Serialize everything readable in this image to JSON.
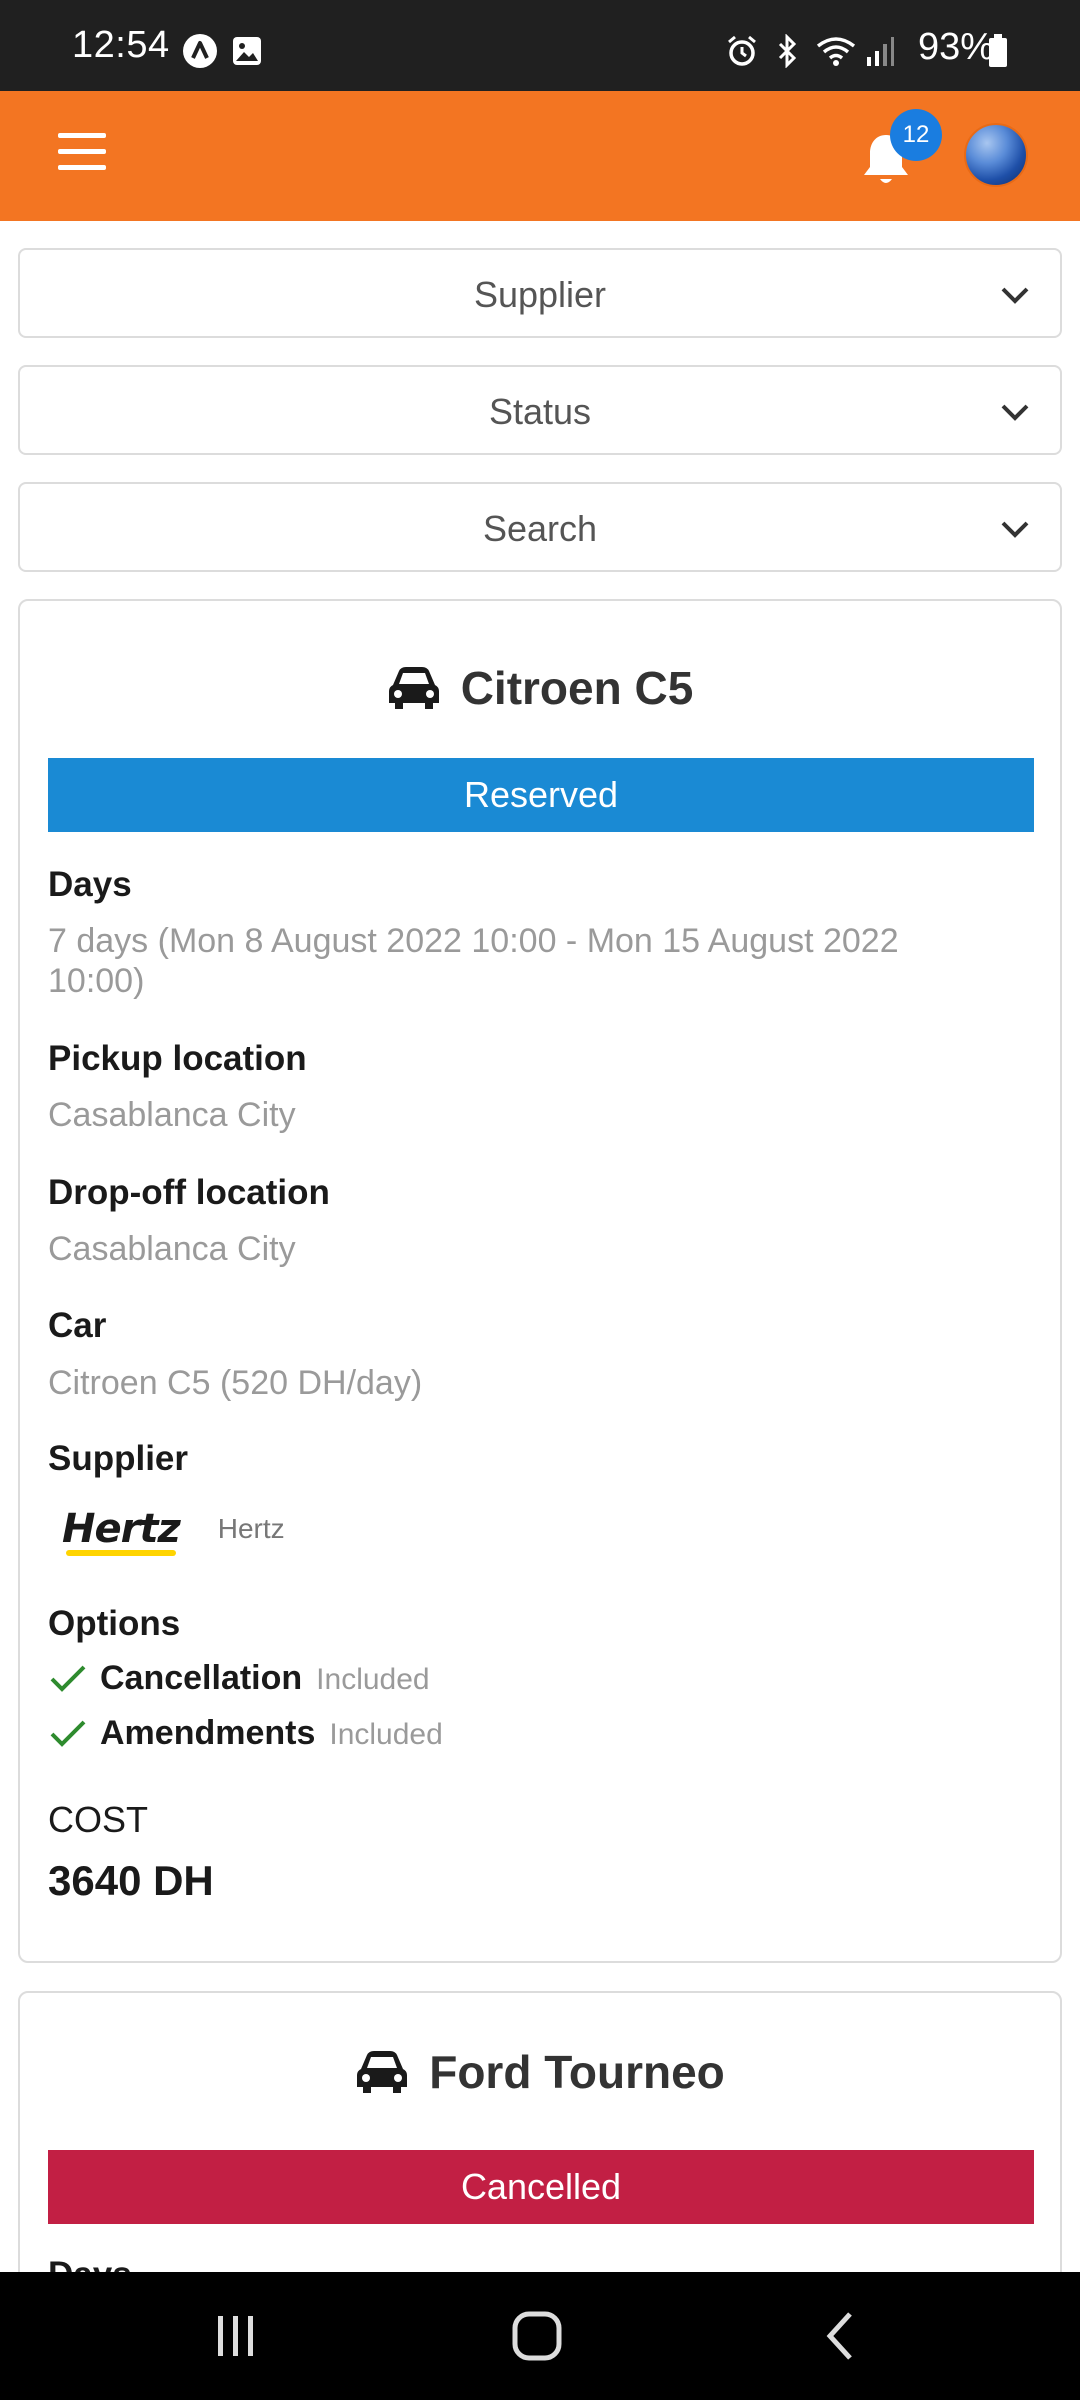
{
  "status_bar": {
    "time": "12:54",
    "battery_text": "93%",
    "icons": [
      "a-circle-icon",
      "image-icon",
      "alarm-icon",
      "bluetooth-icon",
      "wifi-icon",
      "signal-icon",
      "battery-icon"
    ]
  },
  "header": {
    "notification_count": "12",
    "accent_color": "#f37522"
  },
  "filters": {
    "supplier": "Supplier",
    "status": "Status",
    "search": "Search"
  },
  "bookings": [
    {
      "car_name": "Citroen C5",
      "status": "Reserved",
      "status_color": "#1a8ad4",
      "days_label": "Days",
      "days_value": "7 days (Mon 8 August 2022 10:00 - Mon 15 August 2022 10:00)",
      "pickup_label": "Pickup location",
      "pickup_value": "Casablanca City",
      "dropoff_label": "Drop-off location",
      "dropoff_value": "Casablanca City",
      "car_label": "Car",
      "car_value": "Citroen C5 (520  DH/day)",
      "supplier_label": "Supplier",
      "supplier_logo_text": "Hertz",
      "supplier_name": "Hertz",
      "options_label": "Options",
      "options": [
        {
          "name": "Cancellation",
          "status": "Included"
        },
        {
          "name": "Amendments",
          "status": "Included"
        }
      ],
      "cost_label": "COST",
      "cost_value": "3640 DH"
    },
    {
      "car_name": "Ford Tourneo",
      "status": "Cancelled",
      "status_color": "#c21f44",
      "days_label": "Days"
    }
  ]
}
